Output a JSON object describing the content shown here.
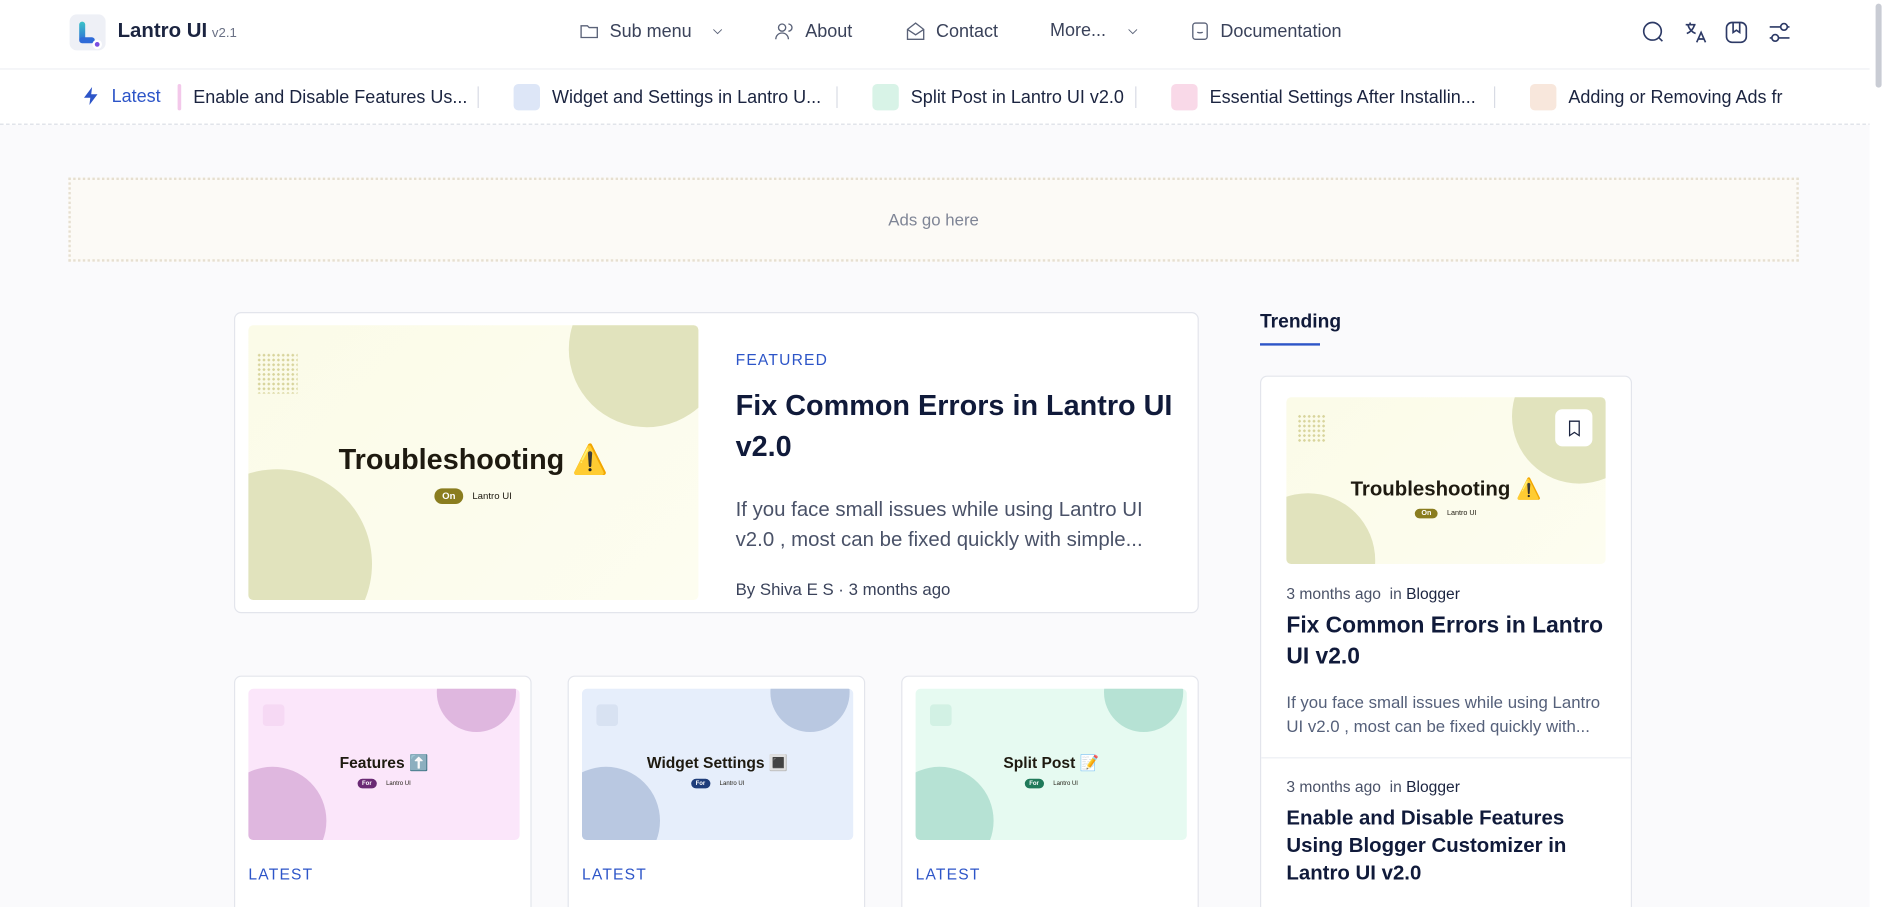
{
  "header": {
    "brand": "Lantro UI",
    "version": "v2.1",
    "nav": [
      {
        "label": "Sub menu",
        "icon": "folder-icon",
        "dropdown": true
      },
      {
        "label": "About",
        "icon": "users-icon",
        "dropdown": false
      },
      {
        "label": "Contact",
        "icon": "mail-icon",
        "dropdown": false
      },
      {
        "label": "More...",
        "icon": "",
        "dropdown": true
      },
      {
        "label": "Documentation",
        "icon": "document-icon",
        "dropdown": false
      }
    ],
    "tools": [
      "search-icon",
      "translate-icon",
      "bookmark-icon",
      "settings-sliders-icon"
    ]
  },
  "ticker": {
    "label": "Latest",
    "items": [
      {
        "text": "Enable and Disable Features Us...",
        "color": "#f3c8ea"
      },
      {
        "text": "Widget and Settings in Lantro U...",
        "color": "#dde6f7"
      },
      {
        "text": "Split Post in Lantro UI v2.0",
        "color": "#d8f3e7"
      },
      {
        "text": "Essential Settings After Installin...",
        "color": "#f9d9e8"
      },
      {
        "text": "Adding or Removing Ads fr",
        "color": "#f8e7dc"
      }
    ]
  },
  "ad": {
    "text": "Ads go here"
  },
  "featured": {
    "category": "FEATURED",
    "title": "Fix Common Errors in Lantro UI v2.0",
    "excerpt": "If you face small issues while using Lantro UI v2.0 , most can be fixed quickly with simple...",
    "byline": "By Shiva E S · 3 months ago",
    "cover": {
      "title": "Troubleshooting ⚠️",
      "pill": "On",
      "pill_text": "Lantro UI"
    }
  },
  "cards": [
    {
      "cover_title": "Features ⬆️",
      "pill": "For",
      "pill_text": "Lantro UI",
      "category": "LATEST",
      "bg": "#fbe6fa",
      "circle": "#dfb7df"
    },
    {
      "cover_title": "Widget Settings 🔳",
      "pill": "For",
      "pill_text": "Lantro UI",
      "category": "LATEST",
      "bg": "#e6eefb",
      "circle": "#b9c8e1"
    },
    {
      "cover_title": "Split Post 📝",
      "pill": "For",
      "pill_text": "Lantro UI",
      "category": "LATEST",
      "bg": "#e6faf1",
      "circle": "#b6e2d4"
    }
  ],
  "trending": {
    "title": "Trending",
    "items": [
      {
        "time": "3 months ago",
        "in_label": "in",
        "category": "Blogger",
        "title": "Fix Common Errors in Lantro UI v2.0",
        "excerpt": "If you face small issues while using Lantro UI v2.0 , most can be fixed quickly with...",
        "cover_title": "Troubleshooting ⚠️",
        "pill": "On",
        "pill_text": "Lantro UI"
      },
      {
        "time": "3 months ago",
        "in_label": "in",
        "category": "Blogger",
        "title": "Enable and Disable Features Using Blogger Customizer in Lantro UI v2.0"
      }
    ]
  }
}
